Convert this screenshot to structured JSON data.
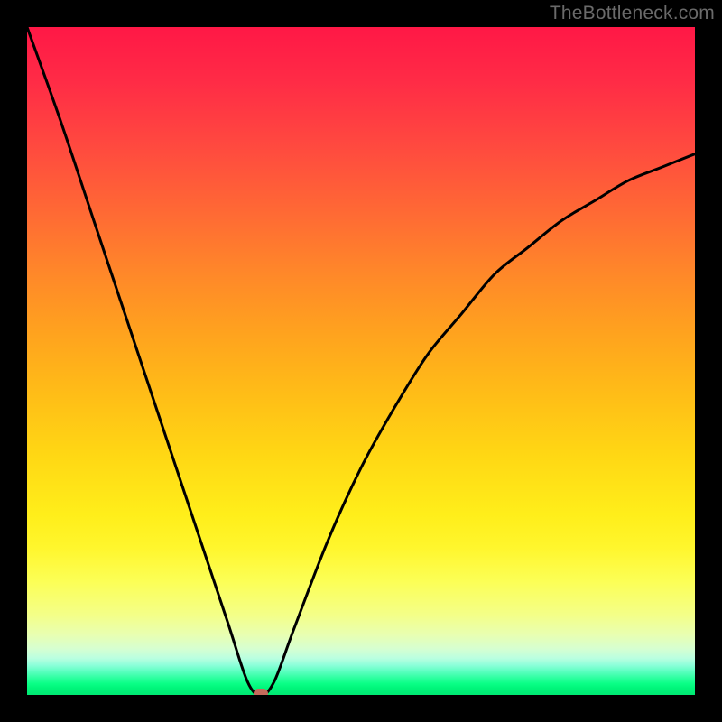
{
  "watermark": {
    "text": "TheBottleneck.com"
  },
  "chart_data": {
    "type": "line",
    "title": "",
    "xlabel": "",
    "ylabel": "",
    "xlim": [
      0,
      100
    ],
    "ylim": [
      0,
      100
    ],
    "grid": false,
    "legend": false,
    "background_gradient": {
      "direction": "vertical",
      "stops": [
        {
          "pos": 0,
          "color": "#ff1846"
        },
        {
          "pos": 50,
          "color": "#ffc316"
        },
        {
          "pos": 85,
          "color": "#fbff4f"
        },
        {
          "pos": 100,
          "color": "#00e873"
        }
      ]
    },
    "series": [
      {
        "name": "bottleneck-curve",
        "color": "#000000",
        "x": [
          0,
          5,
          10,
          15,
          20,
          25,
          30,
          33,
          35,
          37,
          40,
          45,
          50,
          55,
          60,
          65,
          70,
          75,
          80,
          85,
          90,
          95,
          100
        ],
        "values": [
          100,
          86,
          71,
          56,
          41,
          26,
          11,
          2,
          0,
          2,
          10,
          23,
          34,
          43,
          51,
          57,
          63,
          67,
          71,
          74,
          77,
          79,
          81
        ]
      }
    ],
    "marker": {
      "name": "optimal-point",
      "x": 35,
      "y": 0,
      "color": "#c56b5c"
    }
  }
}
